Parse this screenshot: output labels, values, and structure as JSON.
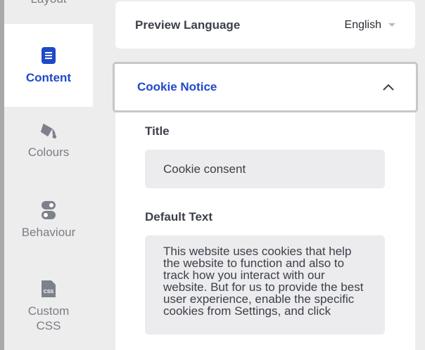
{
  "sidebar": {
    "items": [
      {
        "label": "Layout",
        "icon": "layout-icon"
      },
      {
        "label": "Content",
        "icon": "document-icon",
        "active": true
      },
      {
        "label": "Colours",
        "icon": "paint-bucket-icon"
      },
      {
        "label": "Behaviour",
        "icon": "toggles-icon"
      },
      {
        "label": "Custom\nCSS",
        "icon": "css-file-icon"
      }
    ]
  },
  "preview": {
    "label": "Preview Language",
    "value": "English"
  },
  "section": {
    "title": "Cookie Notice"
  },
  "fields": {
    "title_label": "Title",
    "title_value": "Cookie consent",
    "text_label": "Default Text",
    "text_value": "This website uses cookies that help the website to function and also to track how you interact with our website. But for us to provide the best user experience, enable the specific cookies from Settings, and click"
  },
  "colors": {
    "accent": "#1f49c9",
    "muted_text": "#7a7d84",
    "input_bg": "#ececee"
  }
}
